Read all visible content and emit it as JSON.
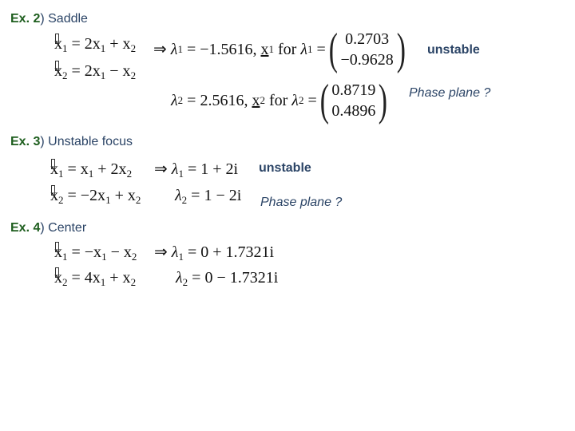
{
  "examples": [
    {
      "label": "Ex. 2",
      "title": ") Saddle",
      "equations": [
        {
          "lhs_var": "x",
          "lhs_sub": "1",
          "rhs": "= 2x",
          "rhs_sub1": "1",
          "rhs_tail": " + x",
          "rhs_sub2": "2"
        },
        {
          "lhs_var": "x",
          "lhs_sub": "2",
          "rhs": "= 2x",
          "rhs_sub1": "1",
          "rhs_tail": " − x",
          "rhs_sub2": "2"
        }
      ],
      "implies": "⇒",
      "eigen": [
        {
          "lambda": "λ",
          "sub": "1",
          "value": "= −1.5616,",
          "vec_name": "x",
          "vec_sub": "1",
          "for_text": "for",
          "vector": [
            "0.2703",
            "−0.9628"
          ]
        },
        {
          "lambda": "λ",
          "sub": "2",
          "value": "= 2.5616,",
          "vec_name": "x",
          "vec_sub": "2",
          "for_text": "for",
          "vector": [
            "0.8719",
            "0.4896"
          ]
        }
      ],
      "stability": "unstable",
      "phase_plane": "Phase plane ?"
    },
    {
      "label": "Ex. 3",
      "title": ") Unstable focus",
      "equations": [
        {
          "lhs_var": "x",
          "lhs_sub": "1",
          "rhs": "= x",
          "rhs_sub1": "1",
          "rhs_tail": " + 2x",
          "rhs_sub2": "2"
        },
        {
          "lhs_var": "x",
          "lhs_sub": "2",
          "rhs": "= −2x",
          "rhs_sub1": "1",
          "rhs_tail": " + x",
          "rhs_sub2": "2"
        }
      ],
      "implies": "⇒",
      "eigen": [
        {
          "lambda": "λ",
          "sub": "1",
          "value": "= 1 + 2i"
        },
        {
          "lambda": "λ",
          "sub": "2",
          "value": "= 1 − 2i"
        }
      ],
      "stability": "unstable",
      "phase_plane": "Phase plane ?"
    },
    {
      "label": "Ex. 4",
      "title": ") Center",
      "equations": [
        {
          "lhs_var": "x",
          "lhs_sub": "1",
          "rhs": "= −x",
          "rhs_sub1": "1",
          "rhs_tail": " − x",
          "rhs_sub2": "2"
        },
        {
          "lhs_var": "x",
          "lhs_sub": "2",
          "rhs": "= 4x",
          "rhs_sub1": "1",
          "rhs_tail": " + x",
          "rhs_sub2": "2"
        }
      ],
      "implies": "⇒",
      "eigen": [
        {
          "lambda": "λ",
          "sub": "1",
          "value": "= 0 + 1.7321i"
        },
        {
          "lambda": "λ",
          "sub": "2",
          "value": "= 0 − 1.7321i"
        }
      ]
    }
  ],
  "colors": {
    "label": "#1e5e1e",
    "heading": "#2b4466"
  }
}
